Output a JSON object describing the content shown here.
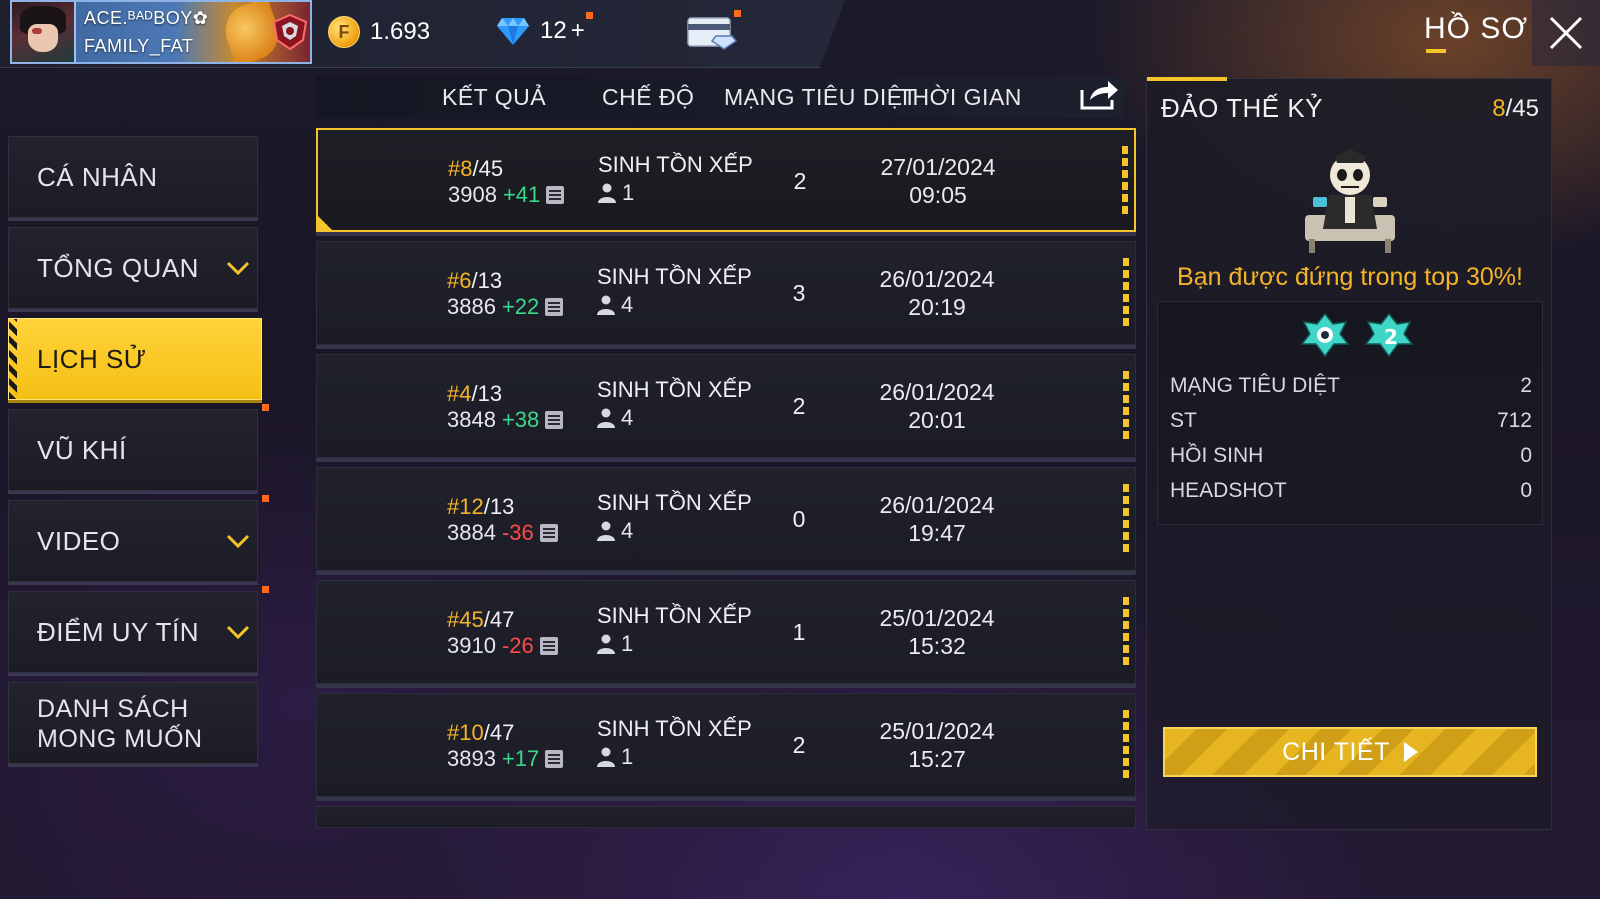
{
  "header": {
    "player_name_line1": "ACE.ᴮᴬᴰBOY✿",
    "player_name_line2": "FAMILY_FAT",
    "gold_amount": "1.693",
    "diamond_amount": "12",
    "diamond_plus": "+",
    "page_title": "HỒ SƠ"
  },
  "sidebar": {
    "items": [
      {
        "label": "CÁ NHÂN"
      },
      {
        "label": "TỔNG QUAN"
      },
      {
        "label": "LỊCH SỬ"
      },
      {
        "label": "VŨ KHÍ"
      },
      {
        "label": "VIDEO"
      },
      {
        "label": "ĐIỂM UY TÍN"
      },
      {
        "label_line1": "DANH SÁCH",
        "label_line2": "MONG MUỐN"
      }
    ]
  },
  "table": {
    "headers": {
      "result": "KẾT QUẢ",
      "mode": "CHẾ ĐỘ",
      "kills": "MẠNG TIÊU DIỆT",
      "time": "THỜI GIAN"
    },
    "rows": [
      {
        "rank": "#8",
        "total": "/45",
        "points": "3908",
        "delta": "+41",
        "mode": "SINH TỒN XẾP HẠ",
        "players": "1",
        "kills": "2",
        "date": "27/01/2024",
        "time": "09:05"
      },
      {
        "rank": "#6",
        "total": "/13",
        "points": "3886",
        "delta": "+22",
        "mode": "SINH TỒN XẾP HẠ",
        "players": "4",
        "kills": "3",
        "date": "26/01/2024",
        "time": "20:19"
      },
      {
        "rank": "#4",
        "total": "/13",
        "points": "3848",
        "delta": "+38",
        "mode": "SINH TỒN XẾP HẠ",
        "players": "4",
        "kills": "2",
        "date": "26/01/2024",
        "time": "20:01"
      },
      {
        "rank": "#12",
        "total": "/13",
        "points": "3884",
        "delta": "-36",
        "mode": "SINH TỒN XẾP HẠ",
        "players": "4",
        "kills": "0",
        "date": "26/01/2024",
        "time": "19:47"
      },
      {
        "rank": "#45",
        "total": "/47",
        "points": "3910",
        "delta": "-26",
        "mode": "SINH TỒN XẾP HẠ",
        "players": "1",
        "kills": "1",
        "date": "25/01/2024",
        "time": "15:32"
      },
      {
        "rank": "#10",
        "total": "/47",
        "points": "3893",
        "delta": "+17",
        "mode": "SINH TỒN XẾP HẠ",
        "players": "1",
        "kills": "2",
        "date": "25/01/2024",
        "time": "15:27"
      }
    ]
  },
  "detail": {
    "map_name": "ĐẢO THẾ KỶ",
    "rank": "8",
    "total": "/45",
    "top_percent_text": "Bạn được đứng trong top 30%!",
    "stats": [
      {
        "label": "MẠNG TIÊU DIỆT",
        "value": "2"
      },
      {
        "label": "ST",
        "value": "712"
      },
      {
        "label": "HỒI SINH",
        "value": "0"
      },
      {
        "label": "HEADSHOT",
        "value": "0"
      }
    ],
    "button_label": "CHI TIẾT"
  },
  "colors": {
    "accent_yellow": "#f5c42a",
    "positive": "#39d98a",
    "negative": "#ff4a4a",
    "rank_highlight": "#f5b32a"
  },
  "icons": [
    "avatar",
    "rank-emblem-icon",
    "gold-coin-icon",
    "diamond-icon",
    "membership-card-icon",
    "close-icon",
    "chevron-down-icon",
    "share-icon",
    "list-icon",
    "person-icon",
    "mascot-icon",
    "badge-icon",
    "play-icon"
  ]
}
